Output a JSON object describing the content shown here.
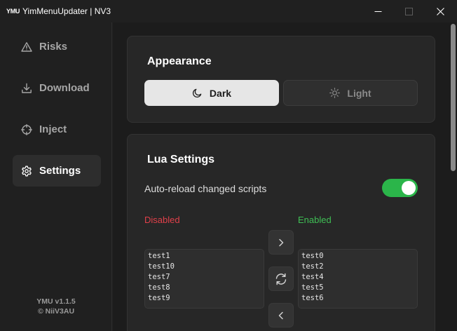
{
  "window": {
    "logo_text": "YMU",
    "title": "YimMenuUpdater | NV3"
  },
  "sidebar": {
    "items": [
      {
        "label": "Risks",
        "icon": "warning-icon",
        "active": false
      },
      {
        "label": "Download",
        "icon": "download-icon",
        "active": false
      },
      {
        "label": "Inject",
        "icon": "crosshair-icon",
        "active": false
      },
      {
        "label": "Settings",
        "icon": "gear-icon",
        "active": true
      }
    ],
    "version": "YMU v1.1.5",
    "author": "© NiiV3AU"
  },
  "appearance": {
    "title": "Appearance",
    "dark_label": "Dark",
    "light_label": "Light",
    "selected": "Dark"
  },
  "lua": {
    "title": "Lua Settings",
    "auto_reload_label": "Auto-reload changed scripts",
    "auto_reload_enabled": true,
    "disabled_label": "Disabled",
    "enabled_label": "Enabled",
    "disabled_scripts": [
      "test1",
      "test10",
      "test7",
      "test8",
      "test9"
    ],
    "enabled_scripts": [
      "test0",
      "test2",
      "test4",
      "test5",
      "test6"
    ]
  },
  "colors": {
    "toggle_on": "#2bb54a",
    "disabled_text": "#e0404a",
    "enabled_text": "#3fbf55"
  }
}
